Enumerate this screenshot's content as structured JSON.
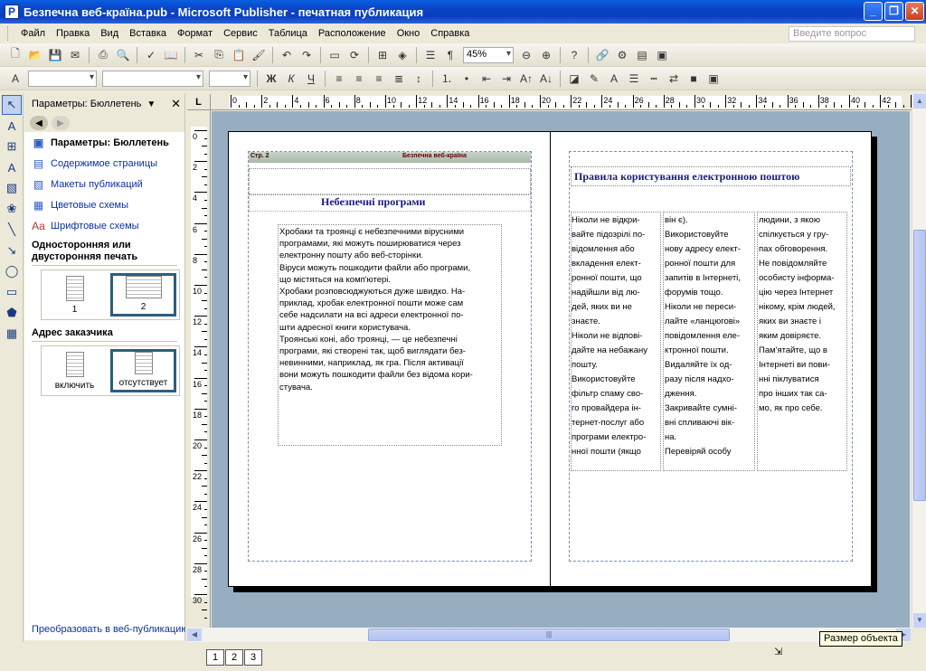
{
  "window": {
    "title": "Безпечна веб-країна.pub - Microsoft Publisher - печатная публикация",
    "app_icon": "P"
  },
  "menu": {
    "items": [
      "Файл",
      "Правка",
      "Вид",
      "Вставка",
      "Формат",
      "Сервис",
      "Таблица",
      "Расположение",
      "Окно",
      "Справка"
    ],
    "help_placeholder": "Введите вопрос"
  },
  "toolbar": {
    "zoom": "45%"
  },
  "taskpane": {
    "header": "Параметры: Бюллетень",
    "links": [
      {
        "label": "Параметры: Бюллетень",
        "icon": "options-icon",
        "bold": true
      },
      {
        "label": "Содержимое страницы",
        "icon": "page-content-icon",
        "bold": false
      },
      {
        "label": "Макеты публикаций",
        "icon": "publication-designs-icon",
        "bold": false
      },
      {
        "label": "Цветовые схемы",
        "icon": "color-schemes-icon",
        "bold": false
      },
      {
        "label": "Шрифтовые схемы",
        "icon": "font-schemes-icon",
        "bold": false
      }
    ],
    "section_print": "Односторонняя или двусторонняя печать",
    "print_options": [
      "1",
      "2"
    ],
    "section_address": "Адрес заказчика",
    "address_options": [
      "включить",
      "отсутствует"
    ],
    "bottom_link": "Преобразовать в веб-публикацию"
  },
  "ruler": {
    "h_labels": [
      "0",
      "2",
      "4",
      "6",
      "8",
      "10",
      "12",
      "14",
      "16",
      "18",
      "20",
      "22",
      "24",
      "26",
      "28",
      "30",
      "32",
      "34",
      "36",
      "38",
      "40",
      "42",
      "44"
    ],
    "v_labels": [
      "0",
      "2",
      "4",
      "6",
      "8",
      "10",
      "12",
      "14",
      "16",
      "18",
      "20",
      "22",
      "24",
      "26",
      "28",
      "30"
    ],
    "corner": "L"
  },
  "document": {
    "left_page": {
      "header_page": "Стр. 2",
      "header_name": "Безпечна веб-країна",
      "title": "Небезпечні програми",
      "lines": [
        "Хробаки та троянці є небезпечними вірусними",
        "програмами, які можуть поширюватися через",
        "електронну пошту або веб-сторінки.",
        "Віруси можуть пошкодити файли або програми,",
        "що містяться на комп'ютері.",
        "Хробаки розповсюджуються дуже швидко. На-",
        "приклад, хробак електронної пошти може сам",
        "себе надсилати на всі адреси електронної по-",
        "шти адресної книги користувача.",
        "Троянські коні, або троянці, — це небезпечні",
        "програми, які створені так, щоб виглядати без-",
        "невинними, наприклад, як гра. Після активації",
        "вони можуть пошкодити файли без відома кори-",
        "стувача."
      ]
    },
    "right_page": {
      "title": "Правила користування електронною поштою",
      "col1": [
        "Ніколи не відкри-",
        "вайте підозрілі по-",
        "відомлення або",
        "вкладення елект-",
        "ронної пошти, що",
        "надійшли від лю-",
        "дей, яких ви не",
        "знаєте.",
        " Ніколи не відпові-",
        "дайте на небажану",
        "пошту.",
        "Використовуйте",
        "фільтр спаму сво-",
        "го провайдера ін-",
        "тернет-послуг або",
        "програми електро-",
        "нної пошти (якщо"
      ],
      "col2": [
        "він є).",
        " Використовуйте",
        "нову адресу елект-",
        "ронної пошти для",
        "запитів в Інтернеті,",
        "форумів тощо.",
        "Ніколи не переси-",
        "лайте «ланцюгові»",
        "повідомлення еле-",
        "ктронної пошти.",
        "Видаляйте їх од-",
        "разу після надхо-",
        "дження.",
        "Закривайте сумні-",
        "вні спливаючі вік-",
        "на.",
        "Перевіряй особу"
      ],
      "col3": [
        "людини, з якою",
        "спілкується у гру-",
        "пах обговорення.",
        "Не повідомляйте",
        "особисту інформа-",
        "цію через Інтернет",
        "нікому, крім людей,",
        "яких ви знаєте і",
        "яким довіряєте.",
        "Пам'ятайте, що в",
        "Інтернеті ви пови-",
        "нні піклуватися",
        "про інших так са-",
        "мо, як про себе."
      ]
    }
  },
  "status": {
    "pages": [
      "1",
      "2",
      "3"
    ],
    "tooltip": "Размер объекта"
  }
}
